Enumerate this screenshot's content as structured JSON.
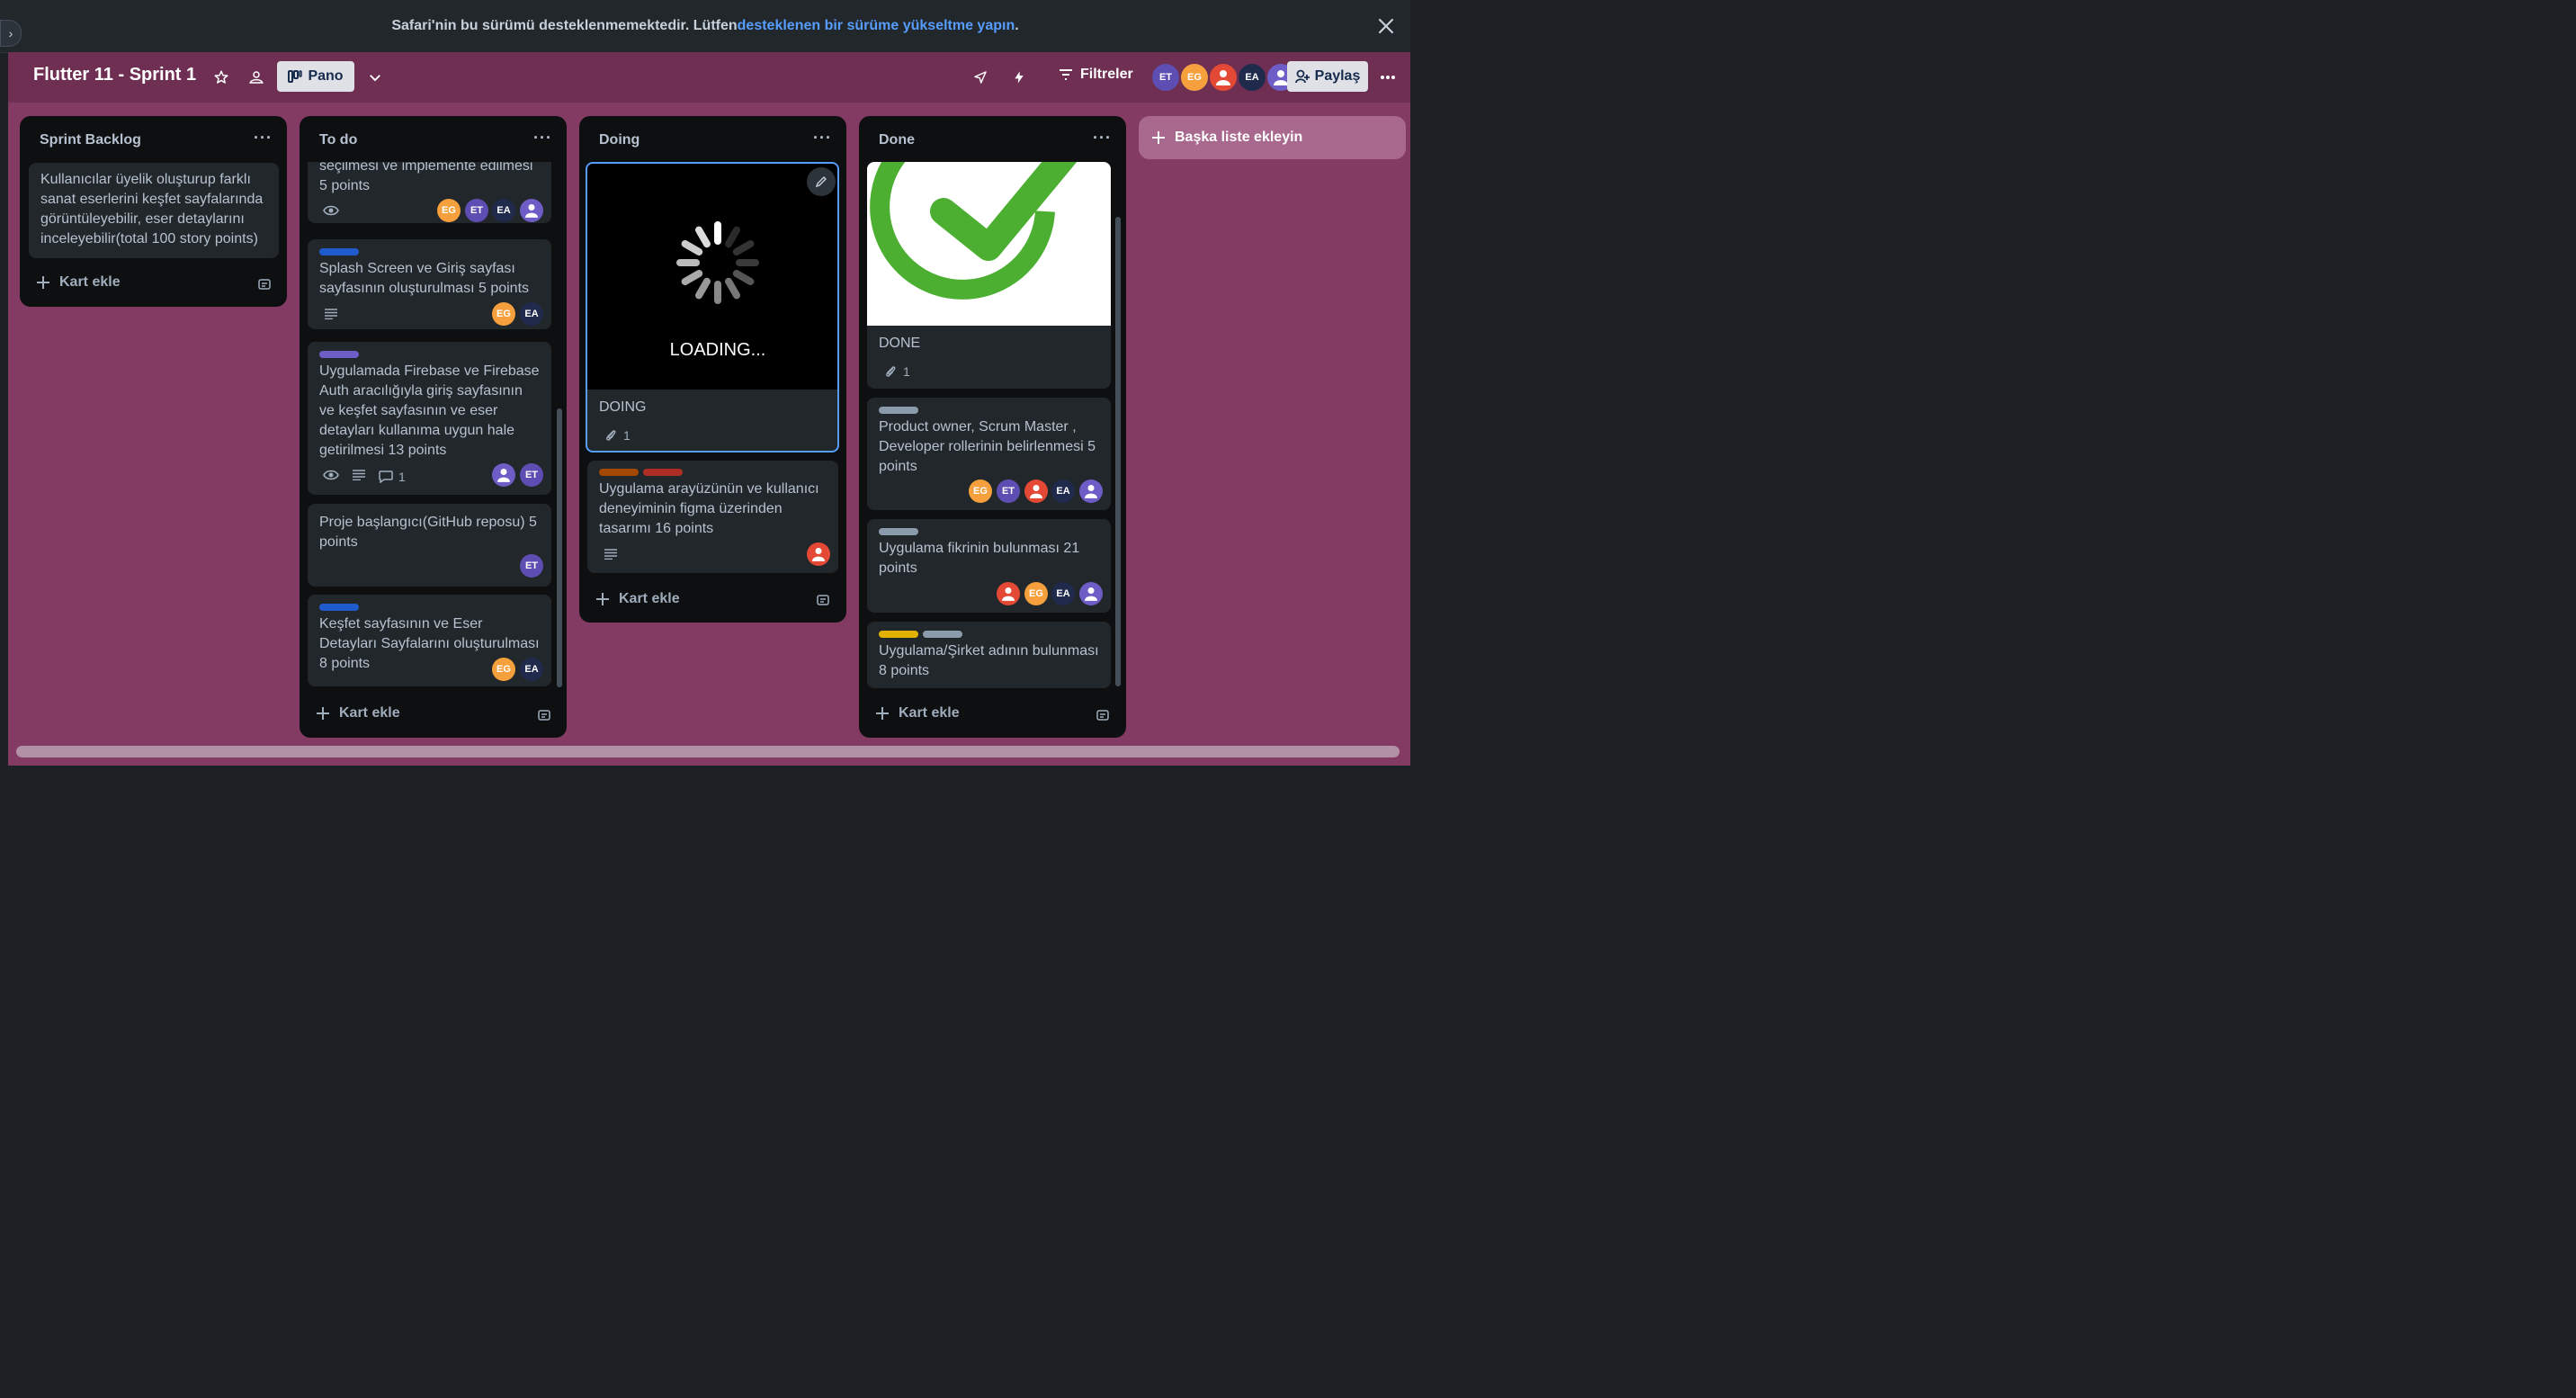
{
  "banner": {
    "text": "Safari'nin bu sürümü desteklenmemektedir. Lütfen ",
    "link": "desteklenen bir sürüme yükseltme yapın",
    "end": "."
  },
  "board": {
    "title": "Flutter 11 - Sprint 1",
    "view_label": "Pano",
    "filters_label": "Filtreler",
    "share_label": "Paylaş",
    "members": [
      {
        "initials": "ET",
        "color": "#5e4db2"
      },
      {
        "initials": "EG",
        "color": "#f5a03d"
      },
      {
        "initials": "",
        "color": "#e34935"
      },
      {
        "initials": "EA",
        "color": "#1f2a4d"
      },
      {
        "initials": "",
        "color": "#6e5dc6"
      }
    ]
  },
  "lists": {
    "backlog": {
      "title": "Sprint Backlog",
      "cards": [
        {
          "text": "Kullanıcılar üyelik oluşturup farklı sanat eserlerini keşfet sayfalarında görüntüleyebilir, eser detaylarını inceleyebilir(total 100 story points)"
        }
      ],
      "add_label": "Kart ekle"
    },
    "todo": {
      "title": "To do",
      "cards": [
        {
          "text": "seçilmesi ve implemente edilmesi 5 points",
          "members": [
            "EG",
            "ET",
            "EA",
            ""
          ]
        },
        {
          "text": "Splash Screen ve Giriş sayfası sayfasının oluşturulması 5 points",
          "members": [
            "EG",
            "EA"
          ]
        },
        {
          "text": "Uygulamada Firebase ve Firebase Auth aracılığıyla giriş sayfasının ve keşfet sayfasının ve eser detayları kullanıma uygun hale getirilmesi 13 points",
          "comments": "1",
          "members": [
            "",
            "ET"
          ]
        },
        {
          "text": "Proje başlangıcı(GitHub reposu) 5 points",
          "members": [
            "ET"
          ]
        },
        {
          "text": "Keşfet sayfasının ve Eser Detayları Sayfalarını oluşturulması 8 points",
          "members": [
            "EG",
            "EA"
          ]
        }
      ],
      "add_label": "Kart ekle"
    },
    "doing": {
      "title": "Doing",
      "cards": [
        {
          "cover_text": "LOADING...",
          "text": "DOING",
          "attachments": "1"
        },
        {
          "text": "Uygulama arayüzünün ve kullanıcı deneyiminin figma üzerinden tasarımı 16 points"
        }
      ],
      "add_label": "Kart ekle"
    },
    "done": {
      "title": "Done",
      "cards": [
        {
          "text": "DONE",
          "attachments": "1"
        },
        {
          "text": "Product owner, Scrum Master , Developer rollerinin belirlenmesi 5 points",
          "members": [
            "EG",
            "ET",
            "",
            "EA",
            ""
          ]
        },
        {
          "text": "Uygulama fikrinin bulunması 21 points",
          "members": [
            "",
            "EG",
            "EA",
            ""
          ]
        },
        {
          "text": "Uygulama/Şirket adının bulunması 8 points"
        }
      ],
      "add_label": "Kart ekle"
    }
  },
  "add_list_label": "Başka liste ekleyin",
  "colors": {
    "board_bg": "#833b64",
    "header_bg": "#6e2f53",
    "list_bg": "#0d0f11",
    "card_bg": "#22272b",
    "label_blue": "#1f5bcc",
    "label_purple": "#6e5dc6",
    "label_orange": "#a54800",
    "label_red": "#ae2e24",
    "label_gray": "#8c9bab",
    "label_yellow": "#e2b203",
    "done_green": "#4caf32"
  }
}
